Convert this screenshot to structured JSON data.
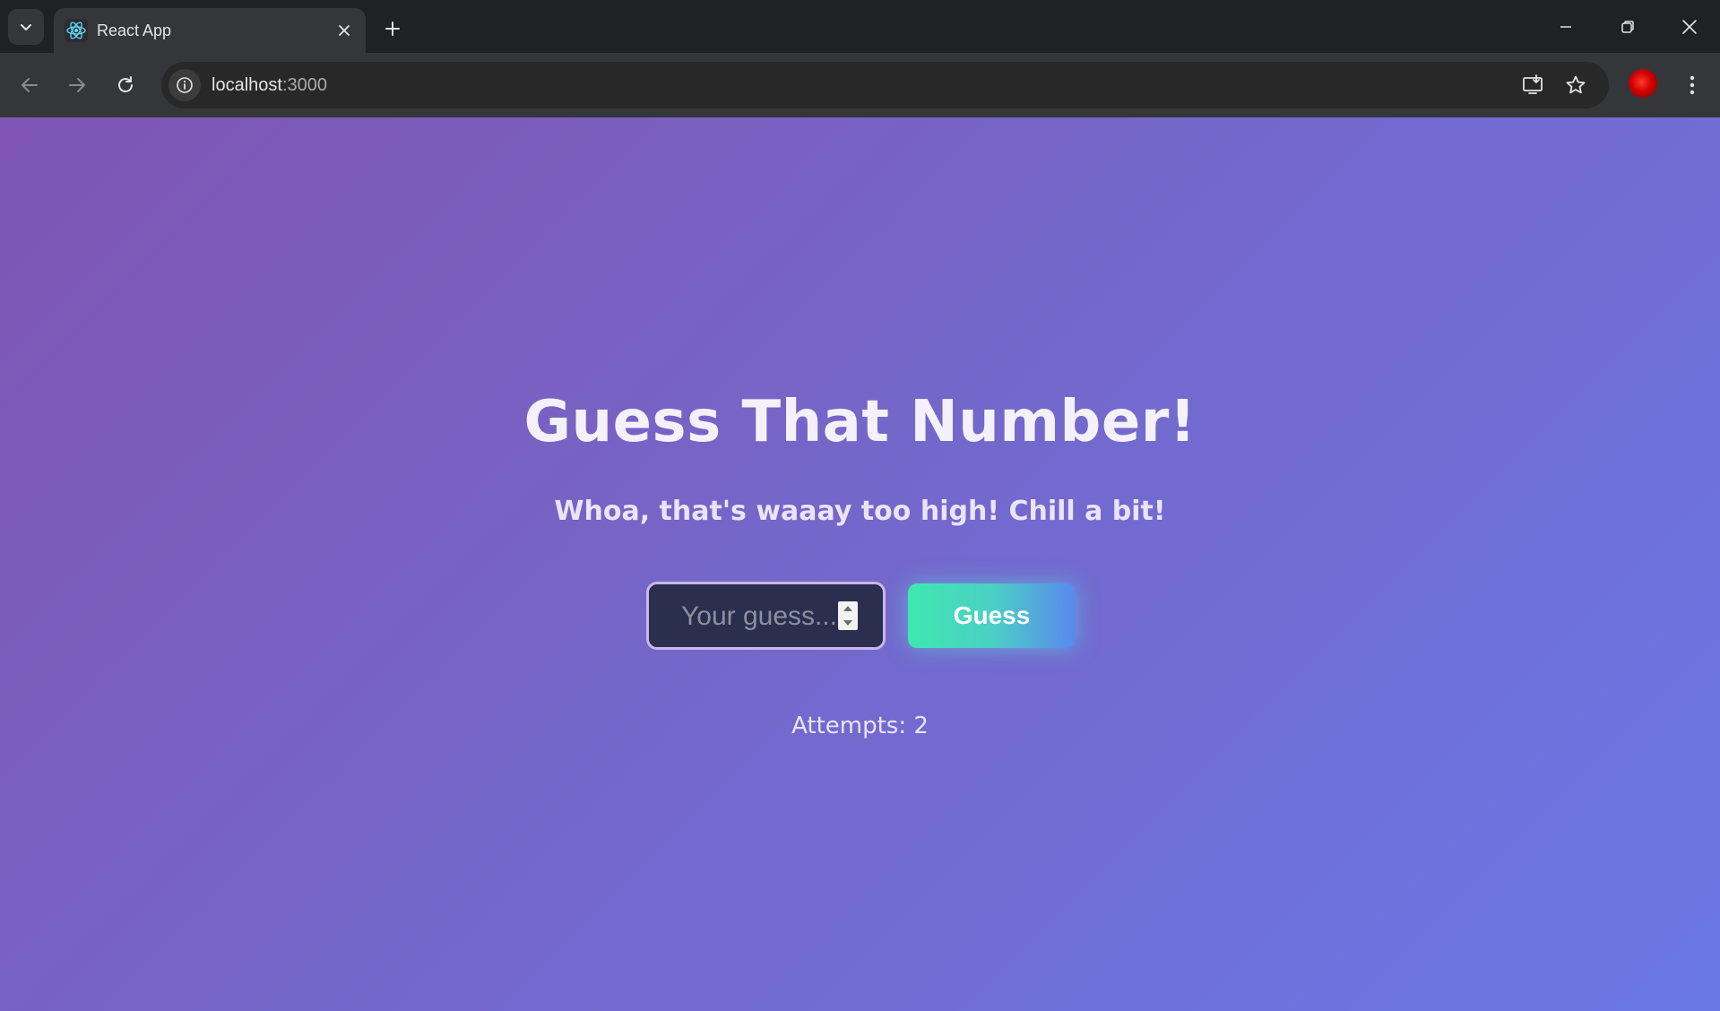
{
  "browser": {
    "tab": {
      "title": "React App",
      "favicon": "react-logo-icon"
    },
    "address_bar": {
      "host": "localhost",
      "port": ":3000"
    },
    "icons": {
      "tab_search": "chevron-down-icon",
      "close_tab": "close-icon",
      "new_tab": "plus-icon",
      "minimize": "minimize-icon",
      "restore": "restore-icon",
      "close_window": "close-icon",
      "back": "arrow-left-icon",
      "forward": "arrow-right-icon",
      "reload": "reload-icon",
      "site_info": "info-icon",
      "install": "install-app-icon",
      "bookmark": "star-icon",
      "menu": "more-vertical-icon"
    }
  },
  "game": {
    "title": "Guess That Number!",
    "message": "Whoa, that's waaay too high! Chill a bit!",
    "input": {
      "placeholder": "Your guess...",
      "value": ""
    },
    "button_label": "Guess",
    "attempts_label": "Attempts: 2"
  },
  "colors": {
    "gradient_start": "#7f55b3",
    "gradient_end": "#6a78e6",
    "input_bg": "#2a2e4f",
    "button_start": "#3ee8b0",
    "button_end": "#5a88ee"
  }
}
